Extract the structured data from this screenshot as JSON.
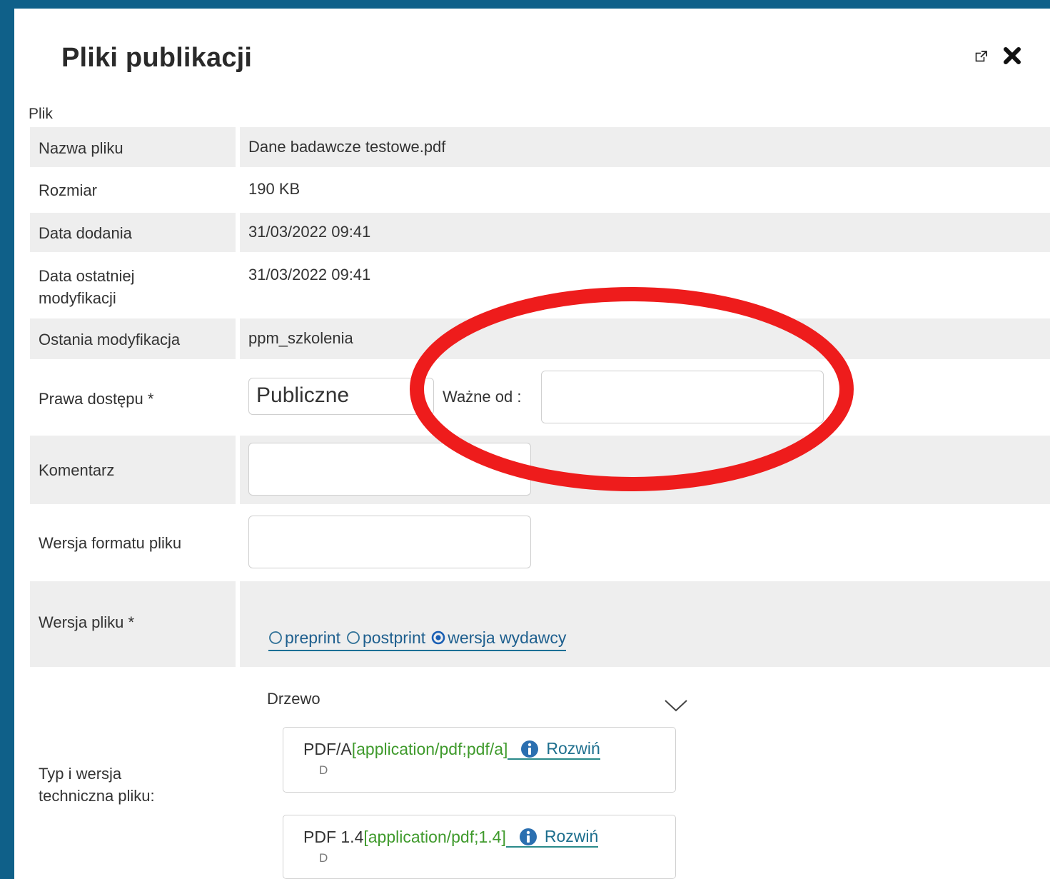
{
  "dialog": {
    "title": "Pliki publikacji",
    "actions": {
      "popout_icon": "external-link-icon",
      "close_icon": "close-x-icon"
    }
  },
  "section": {
    "label": "Plik"
  },
  "details": [
    {
      "label": "Nazwa pliku",
      "value": "Dane badawcze testowe.pdf"
    },
    {
      "label": "Rozmiar",
      "value": "190 KB"
    },
    {
      "label": "Data dodania",
      "value": "31/03/2022 09:41"
    },
    {
      "label": "Data ostatniej modyfikacji",
      "value": "31/03/2022 09:41"
    },
    {
      "label": "Ostania modyfikacja",
      "value": "ppm_szkolenia"
    }
  ],
  "access": {
    "label": "Prawa dostępu *",
    "selected": "Publiczne",
    "valid_from_label": "Ważne od :",
    "valid_from_value": ""
  },
  "comment": {
    "label": "Komentarz",
    "value": ""
  },
  "format_version": {
    "label": "Wersja formatu pliku",
    "value": ""
  },
  "file_version": {
    "label": "Wersja pliku *",
    "options": [
      "preprint",
      "postprint",
      "wersja wydawcy"
    ],
    "selected": "wersja wydawcy"
  },
  "tech_type": {
    "label": "Typ i wersja techniczna pliku:",
    "tree_label": "Drzewo",
    "items": [
      {
        "name": "PDF/A",
        "mime": "[application/pdf;pdf/a]",
        "action": "Rozwiń",
        "sub": "D"
      },
      {
        "name": "PDF 1.4",
        "mime": "[application/pdf;1.4]",
        "action": "Rozwiń",
        "sub": "D"
      }
    ]
  },
  "annotation": {
    "shape": "ellipse",
    "color": "#ee1c1c"
  },
  "colors": {
    "frame": "#0f6089",
    "row_shade": "#eeeeee",
    "link": "#1e5f8e",
    "mime": "#3f9a2c"
  }
}
